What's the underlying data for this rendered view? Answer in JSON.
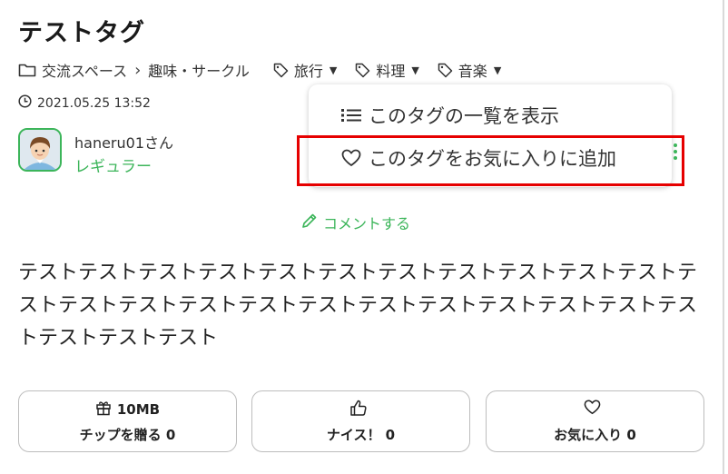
{
  "page": {
    "title": "テストタグ"
  },
  "breadcrumb": {
    "items": [
      "交流スペース",
      "趣味・サークル"
    ],
    "separator": "›"
  },
  "tags": [
    {
      "label": "旅行",
      "icon": "tag-icon"
    },
    {
      "label": "料理",
      "icon": "tag-icon"
    },
    {
      "label": "音楽",
      "icon": "tag-icon"
    }
  ],
  "post": {
    "date": "2021.05.25 13:52",
    "username": "haneru01さん",
    "rank": "レギュラー",
    "comment_label": "コメントする",
    "body": "テストテストテストテストテストテストテストテストテストテストテストテストテストテストテストテストテストテストテストテストテストテストテストテストテストテスト"
  },
  "menu": {
    "items": [
      {
        "label": "このタグの一覧を表示",
        "icon": "list-icon"
      },
      {
        "label": "このタグをお気に入りに追加",
        "icon": "heart-icon"
      }
    ]
  },
  "actions": {
    "tip": {
      "top": "10MB",
      "label": "チップを贈る 0",
      "icon": "gift-icon"
    },
    "nice": {
      "label": "ナイス！ 0",
      "icon": "thumbs-up-icon"
    },
    "fav": {
      "label": "お気に入り 0",
      "icon": "heart-icon"
    }
  },
  "colors": {
    "accent": "#3cb55a",
    "highlight": "#e60000",
    "text": "#222222"
  }
}
